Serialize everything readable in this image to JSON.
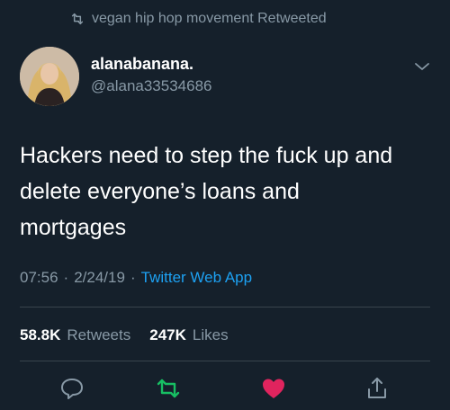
{
  "retweet_header": {
    "text": "vegan hip hop movement Retweeted"
  },
  "author": {
    "display_name": "alanabanana.",
    "handle": "@alana33534686"
  },
  "tweet": {
    "lines": [
      "Hackers need to step the fuck up and",
      "delete everyone’s loans and",
      "mortgages"
    ]
  },
  "meta": {
    "time": "07:56",
    "separator1": "·",
    "date": "2/24/19",
    "separator2": "·",
    "source": "Twitter Web App"
  },
  "stats": {
    "retweets_count": "58.8K",
    "retweets_label": "Retweets",
    "likes_count": "247K",
    "likes_label": "Likes"
  },
  "colors": {
    "background": "#15202b",
    "muted": "#8899a6",
    "link": "#1da1f2",
    "retweet_green": "#17bf63",
    "like_red": "#e0245e",
    "divider": "#38444d"
  },
  "icons": {
    "retweet_header": "retweet-icon",
    "chevron": "chevron-down-icon",
    "reply": "reply-icon",
    "retweet": "retweet-icon",
    "like": "heart-icon",
    "share": "share-icon"
  }
}
